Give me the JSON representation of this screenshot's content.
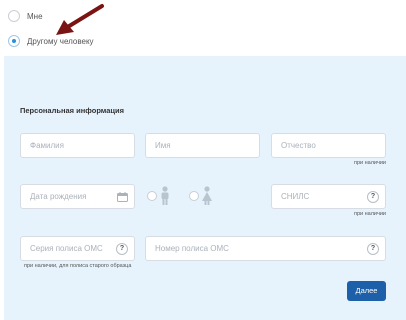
{
  "radio_options": [
    {
      "label": "Мне",
      "selected": false
    },
    {
      "label": "Другому человеку",
      "selected": true
    }
  ],
  "section_title": "Персональная информация",
  "fields": {
    "last_name": {
      "placeholder": "Фамилия"
    },
    "first_name": {
      "placeholder": "Имя"
    },
    "patronymic": {
      "placeholder": "Отчество",
      "hint": "при наличии"
    },
    "birth_date": {
      "placeholder": "Дата рождения"
    },
    "snils": {
      "placeholder": "СНИЛС",
      "hint": "при наличии"
    },
    "policy_series": {
      "placeholder": "Серия полиса ОМС",
      "hint": "при наличии, для полиса старого образца"
    },
    "policy_number": {
      "placeholder": "Номер полиса ОМС"
    }
  },
  "help_glyph": "?",
  "gender_options": [
    "male-icon",
    "female-icon"
  ],
  "next_button": "Далее",
  "colors": {
    "panel": "#e6f3fc",
    "accent": "#2d8fd5",
    "button": "#1d5fa8",
    "arrow": "#7a1414"
  }
}
